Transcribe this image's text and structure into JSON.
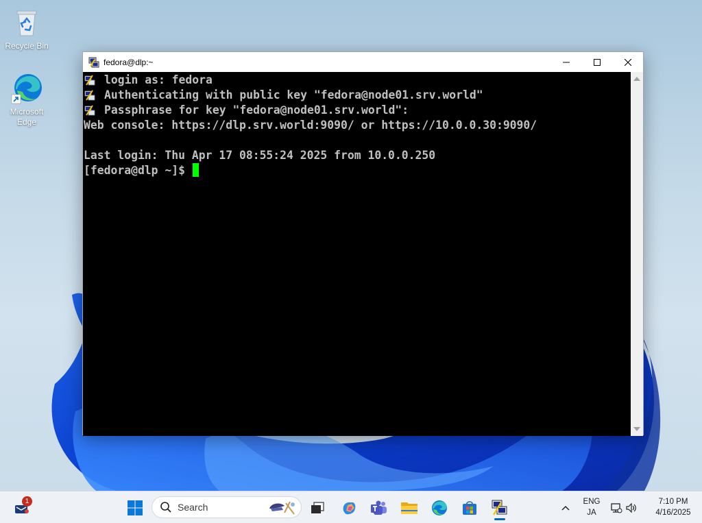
{
  "desktop": {
    "icons": [
      {
        "label": "Recycle Bin"
      },
      {
        "label": "Microsoft Edge"
      }
    ]
  },
  "window": {
    "title": "fedora@dlp:~",
    "terminal_lines": [
      "login as: fedora",
      "Authenticating with public key \"fedora@node01.srv.world\"",
      "Passphrase for key \"fedora@node01.srv.world\":",
      "Web console: https://dlp.srv.world:9090/ or https://10.0.0.30:9090/",
      "",
      "Last login: Thu Apr 17 08:55:24 2025 from 10.0.0.250",
      "[fedora@dlp ~]$ "
    ],
    "cursor_color": "#00ff00",
    "background_color": "#000000",
    "text_color": "#c0c0c0"
  },
  "taskbar": {
    "search_placeholder": "Search",
    "notification_count": "1",
    "language": "ENG",
    "ime": "JA",
    "time": "7:10 PM",
    "date": "4/16/2025",
    "accent": "#0067c0",
    "apps": [
      "start-icon",
      "task-view-icon",
      "copilot-icon",
      "teams-icon",
      "file-explorer-icon",
      "edge-icon",
      "store-icon",
      "putty-icon"
    ]
  }
}
